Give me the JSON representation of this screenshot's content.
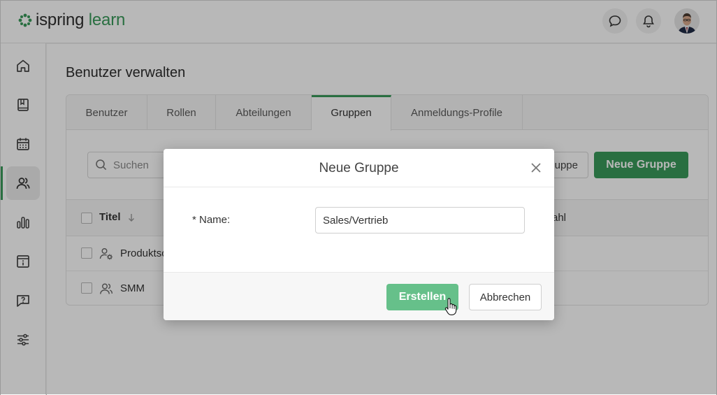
{
  "brand": {
    "name_part1": "ispring",
    "name_part2": "learn",
    "accent": "#3a9a5b"
  },
  "header": {
    "icons": [
      "chat-icon",
      "bell-icon",
      "user-avatar"
    ]
  },
  "sidebar": {
    "items": [
      {
        "icon": "home-icon",
        "active": false
      },
      {
        "icon": "book-icon",
        "active": false
      },
      {
        "icon": "calendar-icon",
        "active": false
      },
      {
        "icon": "users-icon",
        "active": true
      },
      {
        "icon": "bar-chart-icon",
        "active": false
      },
      {
        "icon": "info-box-icon",
        "active": false
      },
      {
        "icon": "question-chat-icon",
        "active": false
      },
      {
        "icon": "settings-sliders-icon",
        "active": false
      }
    ]
  },
  "page": {
    "title": "Benutzer verwalten"
  },
  "tabs": [
    {
      "label": "Benutzer",
      "active": false
    },
    {
      "label": "Rollen",
      "active": false
    },
    {
      "label": "Abteilungen",
      "active": false
    },
    {
      "label": "Gruppen",
      "active": true
    },
    {
      "label": "Anmeldungs-Profile",
      "active": false
    }
  ],
  "toolbar": {
    "search_placeholder": "Suchen",
    "secondary_button_partial": "uppe",
    "new_group_button": "Neue Gruppe"
  },
  "table": {
    "columns": {
      "title": "Titel",
      "count_partial": "ahl"
    },
    "rows": [
      {
        "name": "Produktsc",
        "icon": "user-gear-icon"
      },
      {
        "name": "SMM",
        "icon": "users-icon"
      }
    ]
  },
  "modal": {
    "title": "Neue Gruppe",
    "name_label": "* Name:",
    "name_value": "Sales/Vertrieb",
    "create_button": "Erstellen",
    "cancel_button": "Abbrechen"
  }
}
